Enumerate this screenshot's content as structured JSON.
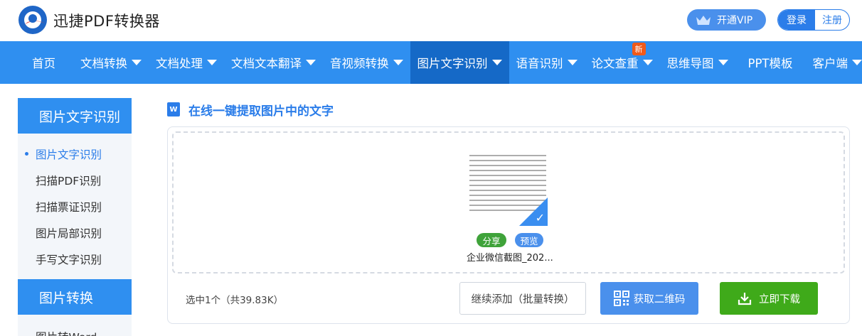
{
  "header": {
    "brand": "迅捷PDF转换器",
    "vip_label": "开通VIP",
    "login_label": "登录",
    "register_label": "注册"
  },
  "nav": {
    "items": [
      {
        "label": "首页",
        "dropdown": false
      },
      {
        "label": "文档转换",
        "dropdown": true
      },
      {
        "label": "文档处理",
        "dropdown": true
      },
      {
        "label": "文档文本翻译",
        "dropdown": true
      },
      {
        "label": "音视频转换",
        "dropdown": true
      },
      {
        "label": "图片文字识别",
        "dropdown": true,
        "active": true
      },
      {
        "label": "语音识别",
        "dropdown": true
      },
      {
        "label": "论文查重",
        "dropdown": true,
        "badge": "新"
      },
      {
        "label": "思维导图",
        "dropdown": true
      },
      {
        "label": "PPT模板",
        "dropdown": false
      },
      {
        "label": "客户端",
        "dropdown": true
      }
    ]
  },
  "sidebar": {
    "section1_title": "图片文字识别",
    "items": [
      {
        "label": "图片文字识别",
        "active": true
      },
      {
        "label": "扫描PDF识别"
      },
      {
        "label": "扫描票证识别"
      },
      {
        "label": "图片局部识别"
      },
      {
        "label": "手写文字识别"
      }
    ],
    "section2_title": "图片转换",
    "section2_items": [
      "图片转Word"
    ]
  },
  "main": {
    "title": "在线一键提取图片中的文字",
    "title_icon_letter": "W",
    "file": {
      "share_label": "分享",
      "preview_label": "预览",
      "name": "企业微信截图_202..."
    },
    "selection_info": "选中1个（共39.83K）",
    "buttons": {
      "add_more": "继续添加（批量转换）",
      "qr": "获取二维码",
      "download": "立即下载"
    }
  },
  "colors": {
    "accent": "#2f8ff0",
    "nav_active": "#1569c7",
    "download_green": "#3faa1a",
    "badge_orange": "#f05a1a"
  }
}
